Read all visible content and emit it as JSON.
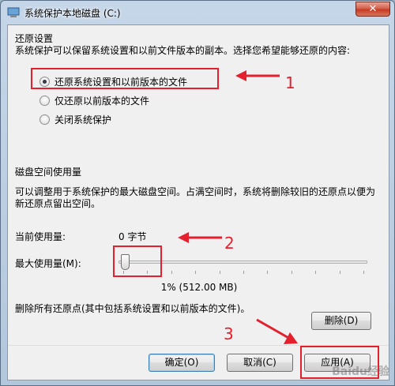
{
  "window": {
    "title": "系统保护本地磁盘 (C:)",
    "close_label": "✕"
  },
  "restore": {
    "section_title": "还原设置",
    "description": "系统保护可以保留系统设置和以前文件版本的副本。选择您希望能够还原的内容:",
    "options": [
      {
        "label": "还原系统设置和以前版本的文件",
        "checked": true
      },
      {
        "label": "仅还原以前版本的文件",
        "checked": false
      },
      {
        "label": "关闭系统保护",
        "checked": false
      }
    ]
  },
  "disk": {
    "section_title": "磁盘空间使用量",
    "description": "可以调整用于系统保护的最大磁盘空间。占满空间时，系统将删除较旧的还原点以便为新还原点留出空间。",
    "current_label": "当前使用量:",
    "current_value": "0 字节",
    "max_label": "最大使用量(M):",
    "slider_percent": 1,
    "slider_text": "1% (512.00 MB)"
  },
  "delete": {
    "description": "删除所有还原点(其中包括系统设置和以前版本的文件)。",
    "button_label": "删除(D)"
  },
  "footer": {
    "ok_label": "确定(O)",
    "cancel_label": "取消(C)",
    "apply_label": "应用(A)"
  },
  "annotations": {
    "num1": "1",
    "num2": "2",
    "num3": "3",
    "color": "#e5202e"
  },
  "watermark": "Baidu经验"
}
